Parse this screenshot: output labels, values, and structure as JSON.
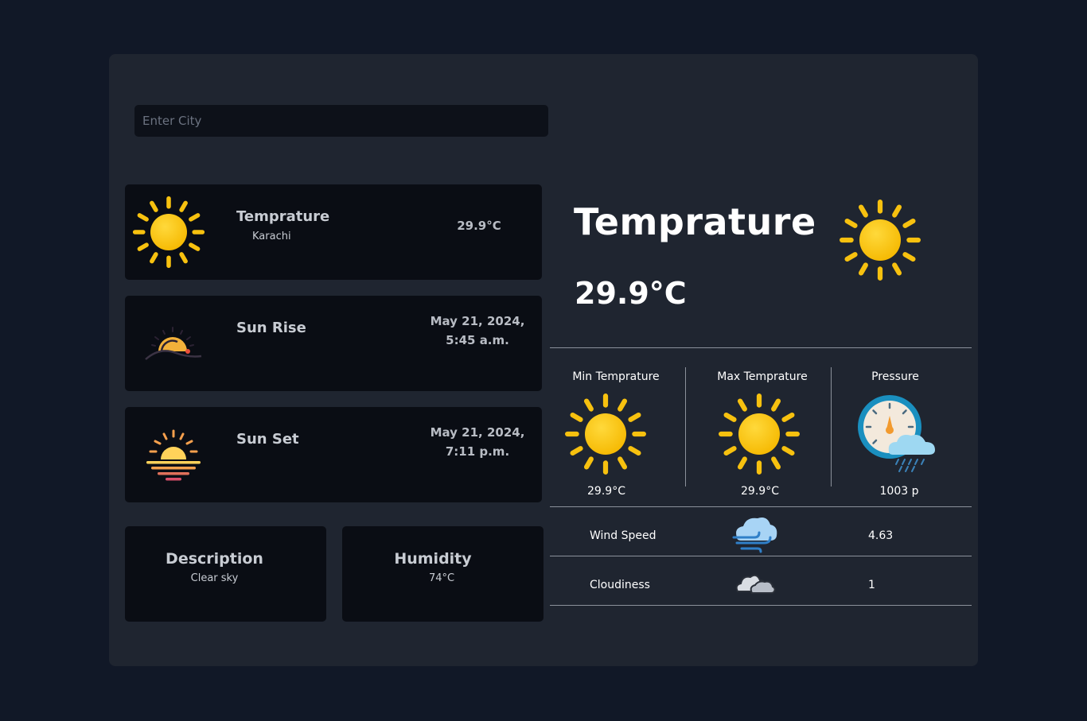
{
  "search": {
    "placeholder": "Enter City"
  },
  "cards": {
    "temperature": {
      "title": "Temprature",
      "city": "Karachi",
      "value": "29.9°C"
    },
    "sunrise": {
      "title": "Sun Rise",
      "value": "May 21, 2024, 5:45 a.m."
    },
    "sunset": {
      "title": "Sun Set",
      "value": "May 21, 2024, 7:11 p.m."
    },
    "description": {
      "title": "Description",
      "value": "Clear sky"
    },
    "humidity": {
      "title": "Humidity",
      "value": "74°C"
    }
  },
  "main": {
    "title": "Temprature",
    "temperature": "29.9°C",
    "stats": [
      {
        "label": "Min Temprature",
        "value": "29.9°C",
        "icon": "sun-icon"
      },
      {
        "label": "Max Temprature",
        "value": "29.9°C",
        "icon": "sun-icon"
      },
      {
        "label": "Pressure",
        "value": "1003 p",
        "icon": "pressure-gauge-icon"
      }
    ],
    "rows": [
      {
        "label": "Wind Speed",
        "value": "4.63",
        "icon": "wind-cloud-icon"
      },
      {
        "label": "Cloudiness",
        "value": "1",
        "icon": "clouds-icon"
      }
    ]
  },
  "colors": {
    "background": "#111827",
    "panel": "#1f2530",
    "card": "#0a0d14",
    "sun": "#fbbf24"
  }
}
